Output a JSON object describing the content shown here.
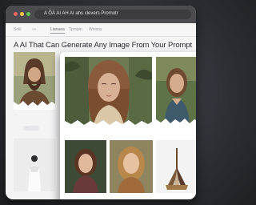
{
  "window": {
    "address_text": "A  ÕÄ   AI AH AI ahs clevers Promotr"
  },
  "nav": {
    "items": [
      "Soiil",
      "»»",
      "Lianaea",
      "Tpmpin",
      "Wnisny"
    ],
    "active_index": 2
  },
  "headline": "A AI That Can Generate Any Image From Your Prompt",
  "icons": {
    "window_controls": [
      "close-dot",
      "minimize-dot",
      "maximize-dot"
    ],
    "address": "lock-icon"
  },
  "colors": {
    "titlebar": "#4b4b50",
    "page_bg": "#f4f4f5",
    "card_bg": "#ffffff",
    "backdrop": "#2d2f35"
  },
  "gallery_back": {
    "captions": [
      "····",
      "——"
    ],
    "badge": "···"
  }
}
